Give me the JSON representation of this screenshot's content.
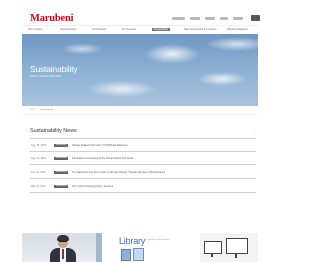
{
  "header": {
    "logo": "Marubeni",
    "utility_links": [
      "",
      "",
      "",
      "",
      ""
    ]
  },
  "nav": {
    "items": [
      {
        "label": "Our Company",
        "active": false
      },
      {
        "label": "News Releases",
        "active": false
      },
      {
        "label": "Our Business",
        "active": false
      },
      {
        "label": "For Investors",
        "active": false
      },
      {
        "label": "Sustainability",
        "active": true
      },
      {
        "label": "Talent Development & Careers",
        "active": false
      },
      {
        "label": "Marubeni Magazine",
        "active": false
      }
    ]
  },
  "hero": {
    "title": "Sustainability",
    "subtitle": "Library / Data & Information"
  },
  "breadcrumb": {
    "home": "TOP",
    "current": "Sustainability"
  },
  "news": {
    "heading": "Sustainability News",
    "more_label": "›",
    "items": [
      {
        "date": "Aug. 30, 2023",
        "tag": "Sustainability",
        "title": "Climate Related Information: TCFD(Final) Statement"
      },
      {
        "date": "Aug. 30, 2023",
        "tag": "Sustainability",
        "title": "Information incorporating of the Human Rights Self Check"
      },
      {
        "date": "Jun. 21, 2023",
        "tag": "Sustainability",
        "title": "The Marubeni Long-Term Vision on Climate Change: Towards Net-Zero GHG Emissions"
      },
      {
        "date": "Mar. 31, 2023",
        "tag": "Sustainability",
        "title": "Our Lumber Sourcing Policy / Services"
      }
    ]
  },
  "library": {
    "title": "Library",
    "subtitle": "Sustainability Data & Reports"
  },
  "colors": {
    "brand_red": "#d9001b",
    "library_blue": "#3f6ab3",
    "tag_gray": "#666666"
  }
}
